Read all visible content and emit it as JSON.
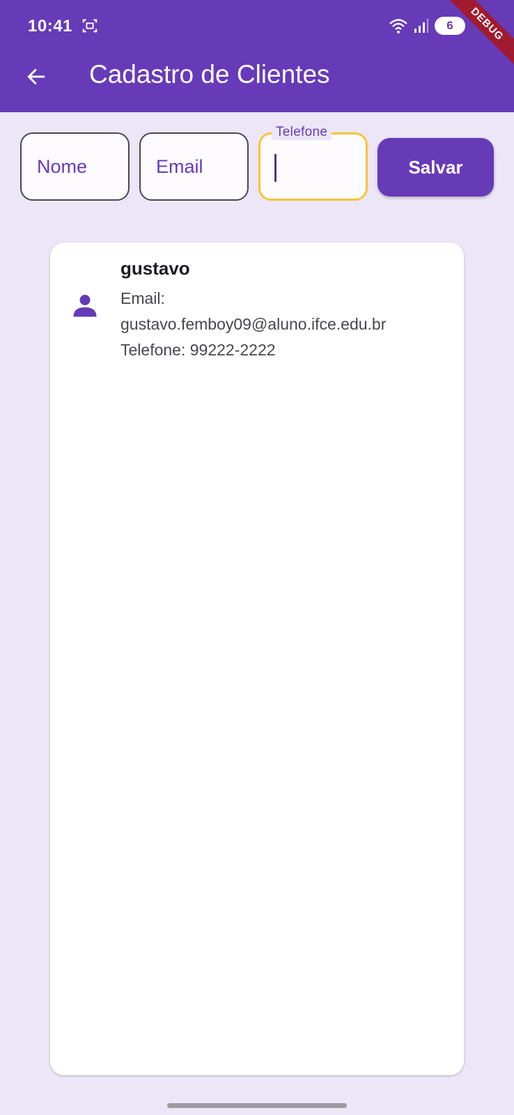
{
  "status_bar": {
    "time": "10:41",
    "battery": "6",
    "icons": [
      "screenshot-icon",
      "wifi-icon",
      "signal-icon",
      "battery-icon"
    ]
  },
  "debug_banner": "DEBUG",
  "app_bar": {
    "title": "Cadastro de Clientes",
    "back_icon": "arrow-back-icon"
  },
  "form": {
    "nome_placeholder": "Nome",
    "email_placeholder": "Email",
    "telefone_label": "Telefone",
    "telefone_value": "",
    "save_label": "Salvar"
  },
  "clients": [
    {
      "name": "gustavo",
      "email_label": "Email:",
      "email": "gustavo.femboy09@aluno.ifce.edu.br",
      "phone_line": "Telefone: 99222-2222"
    }
  ],
  "colors": {
    "primary": "#673AB7",
    "background": "#ECE6F6",
    "focus_border": "#F6C33B",
    "debug_banner": "#A01B30"
  }
}
